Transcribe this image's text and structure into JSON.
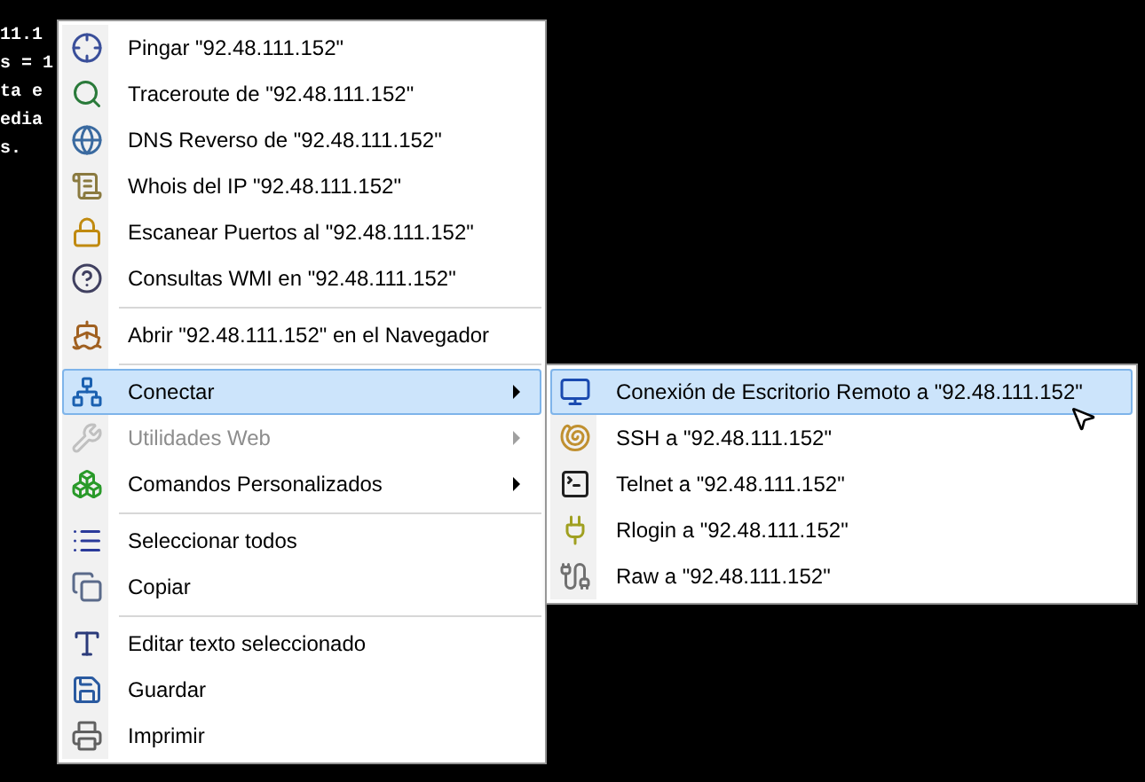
{
  "terminal": {
    "lines": [
      "11.1",
      "s = 1",
      "ta e",
      "edia",
      "s."
    ]
  },
  "menu": {
    "items": [
      {
        "kind": "item",
        "label": "Pingar \"92.48.111.152\"",
        "selected": false,
        "disabled": false,
        "submenu": false
      },
      {
        "kind": "item",
        "label": "Traceroute de \"92.48.111.152\"",
        "selected": false,
        "disabled": false,
        "submenu": false
      },
      {
        "kind": "item",
        "label": "DNS Reverso de \"92.48.111.152\"",
        "selected": false,
        "disabled": false,
        "submenu": false
      },
      {
        "kind": "item",
        "label": "Whois del IP \"92.48.111.152\"",
        "selected": false,
        "disabled": false,
        "submenu": false
      },
      {
        "kind": "item",
        "label": "Escanear Puertos al \"92.48.111.152\"",
        "selected": false,
        "disabled": false,
        "submenu": false
      },
      {
        "kind": "item",
        "label": "Consultas WMI en \"92.48.111.152\"",
        "selected": false,
        "disabled": false,
        "submenu": false
      },
      {
        "kind": "separator"
      },
      {
        "kind": "item",
        "label": "Abrir \"92.48.111.152\" en el Navegador",
        "selected": false,
        "disabled": false,
        "submenu": false
      },
      {
        "kind": "separator"
      },
      {
        "kind": "item",
        "label": "Conectar",
        "selected": true,
        "disabled": false,
        "submenu": true
      },
      {
        "kind": "item",
        "label": "Utilidades Web",
        "selected": false,
        "disabled": true,
        "submenu": true
      },
      {
        "kind": "item",
        "label": "Comandos Personalizados",
        "selected": false,
        "disabled": false,
        "submenu": true
      },
      {
        "kind": "separator"
      },
      {
        "kind": "item",
        "label": "Seleccionar todos",
        "selected": false,
        "disabled": false,
        "submenu": false
      },
      {
        "kind": "item",
        "label": "Copiar",
        "selected": false,
        "disabled": false,
        "submenu": false
      },
      {
        "kind": "separator"
      },
      {
        "kind": "item",
        "label": "Editar texto seleccionado",
        "selected": false,
        "disabled": false,
        "submenu": false
      },
      {
        "kind": "item",
        "label": "Guardar",
        "selected": false,
        "disabled": false,
        "submenu": false
      },
      {
        "kind": "item",
        "label": "Imprimir",
        "selected": false,
        "disabled": false,
        "submenu": false
      }
    ]
  },
  "submenu": {
    "items": [
      {
        "kind": "item",
        "label": "Conexión de Escritorio Remoto a \"92.48.111.152\"",
        "selected": true,
        "disabled": false,
        "submenu": false
      },
      {
        "kind": "item",
        "label": "SSH a \"92.48.111.152\"",
        "selected": false,
        "disabled": false,
        "submenu": false
      },
      {
        "kind": "item",
        "label": "Telnet a \"92.48.111.152\"",
        "selected": false,
        "disabled": false,
        "submenu": false
      },
      {
        "kind": "item",
        "label": "Rlogin a \"92.48.111.152\"",
        "selected": false,
        "disabled": false,
        "submenu": false
      },
      {
        "kind": "item",
        "label": "Raw a \"92.48.111.152\"",
        "selected": false,
        "disabled": false,
        "submenu": false
      }
    ]
  }
}
